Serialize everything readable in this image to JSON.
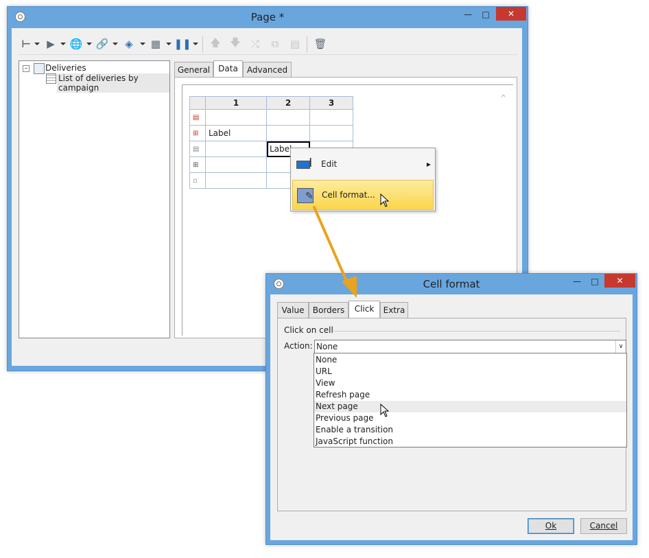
{
  "page_window": {
    "title": "Page *",
    "tree": {
      "root": "Deliveries",
      "child": "List of deliveries by campaign"
    },
    "tabs": [
      "General",
      "Data",
      "Advanced"
    ],
    "active_tab": "Data",
    "grid": {
      "columns": [
        "1",
        "2",
        "3"
      ],
      "rows": [
        {
          "c1": "",
          "c2": "",
          "c3": ""
        },
        {
          "c1": "Label",
          "c2": "",
          "c3": ""
        },
        {
          "c1": "",
          "c2": "Label",
          "c3": ""
        },
        {
          "c1": "",
          "c2": "",
          "c3": ""
        },
        {
          "c1": "",
          "c2": "",
          "c3": ""
        }
      ]
    }
  },
  "context_menu": {
    "items": [
      "Edit",
      "Cell format..."
    ],
    "highlighted": "Cell format..."
  },
  "cell_format_dialog": {
    "title": "Cell format",
    "tabs": [
      "Value",
      "Borders",
      "Click",
      "Extra"
    ],
    "active_tab": "Click",
    "group_label": "Click on cell",
    "action_label": "Action:",
    "action_value": "None",
    "options": [
      "None",
      "URL",
      "View",
      "Refresh page",
      "Next page",
      "Previous page",
      "Enable a transition",
      "JavaScript function"
    ],
    "hovered_option": "Next page",
    "ok_label": "Ok",
    "cancel_label": "Cancel"
  },
  "colors": {
    "window_frame": "#69a6de",
    "close_red": "#c7392f",
    "menu_highlight": "#fbd54a",
    "arrow": "#e9a31e"
  }
}
